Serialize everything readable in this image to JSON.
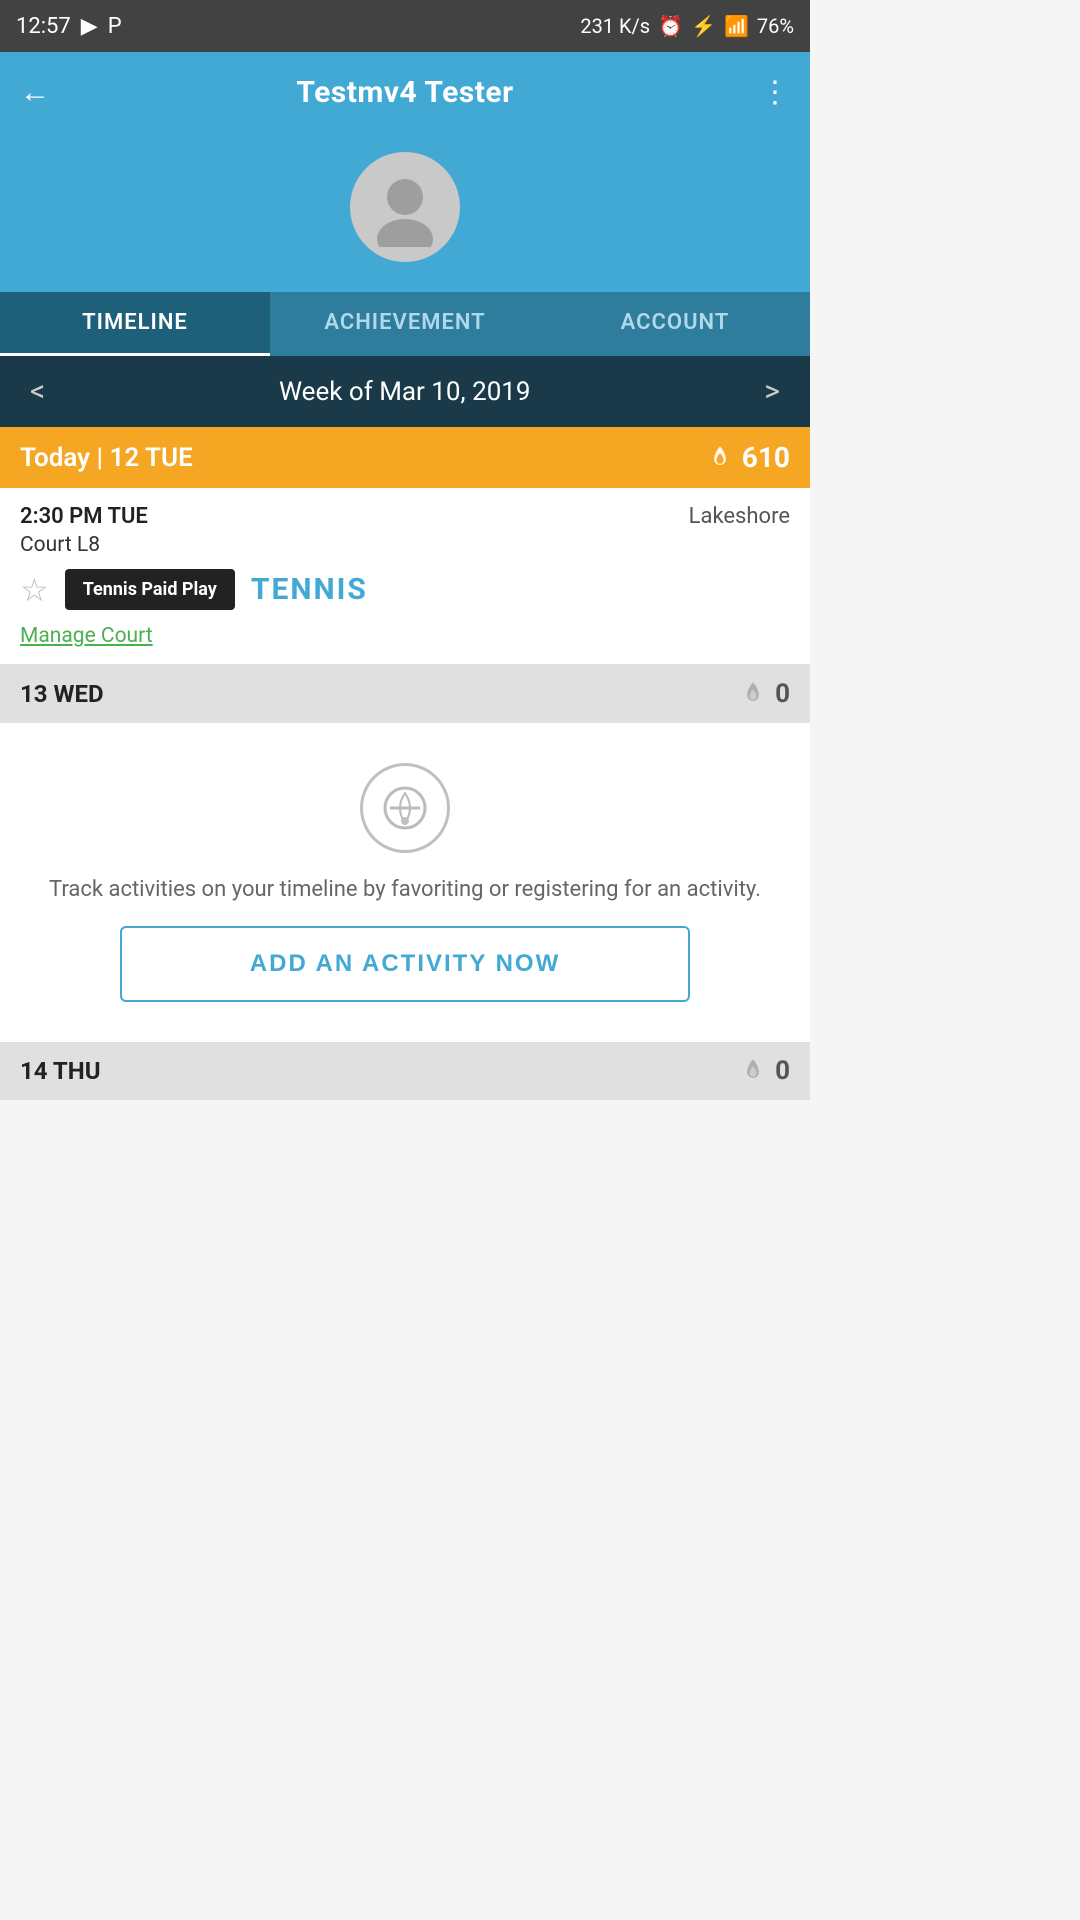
{
  "statusBar": {
    "time": "12:57",
    "network": "231 K/s",
    "battery": "76%"
  },
  "header": {
    "title": "Testmv4 Tester",
    "backLabel": "←",
    "menuLabel": "⋮"
  },
  "tabs": [
    {
      "id": "timeline",
      "label": "TIMELINE",
      "active": true
    },
    {
      "id": "achievement",
      "label": "ACHIEVEMENT",
      "active": false
    },
    {
      "id": "account",
      "label": "ACCOUNT",
      "active": false
    }
  ],
  "weekNav": {
    "label": "Week of Mar 10, 2019",
    "prevLabel": "<",
    "nextLabel": ">"
  },
  "days": [
    {
      "id": "tue",
      "label": "Today | 12 TUE",
      "isToday": true,
      "score": 610,
      "activities": [
        {
          "time": "2:30 PM TUE",
          "location": "Lakeshore",
          "court": "Court L8",
          "badgeText": "Tennis Paid Play",
          "sportLabel": "TENNIS",
          "manageLink": "Manage Court"
        }
      ]
    },
    {
      "id": "wed",
      "label": "13 WED",
      "isToday": false,
      "score": 0,
      "activities": [],
      "emptyState": {
        "description": "Track activities on your timeline by favoriting or registering for an activity.",
        "buttonLabel": "ADD AN ACTIVITY NOW"
      }
    },
    {
      "id": "thu",
      "label": "14 THU",
      "isToday": false,
      "score": 0,
      "activities": []
    }
  ]
}
